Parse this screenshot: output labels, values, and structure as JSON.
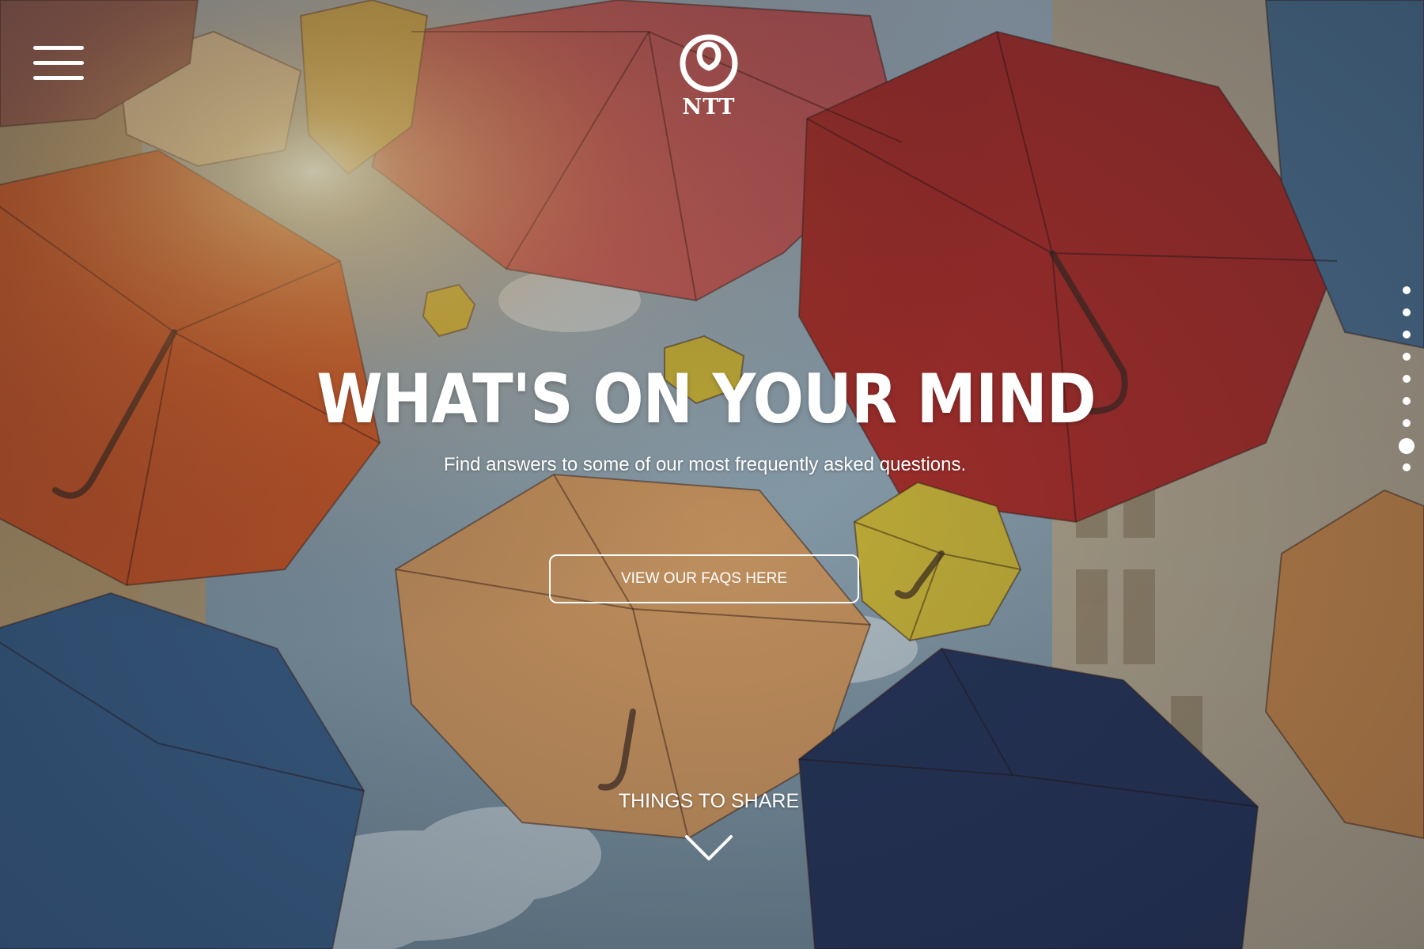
{
  "brand": {
    "logo_text": "NTT",
    "accent": "#ffffff"
  },
  "header": {
    "menu_icon": "hamburger-menu-icon"
  },
  "hero": {
    "headline": "WHAT'S ON YOUR MIND",
    "subtitle": "Find answers to some of our most frequently asked questions.",
    "cta_label": "VIEW OUR FAQS HERE",
    "background": "photo of colorful umbrellas against a sunny sky",
    "colors": {
      "red": "#a8302c",
      "orange": "#c8622a",
      "tan": "#c99560",
      "blue": "#3b5f86",
      "navy": "#27365a",
      "yellow": "#c9b53a",
      "sky": "#8aa2b2"
    }
  },
  "footer_prompt": {
    "label": "THINGS TO SHARE",
    "icon": "chevron-down-icon"
  },
  "pager": {
    "count": 9,
    "active_index": 7
  }
}
